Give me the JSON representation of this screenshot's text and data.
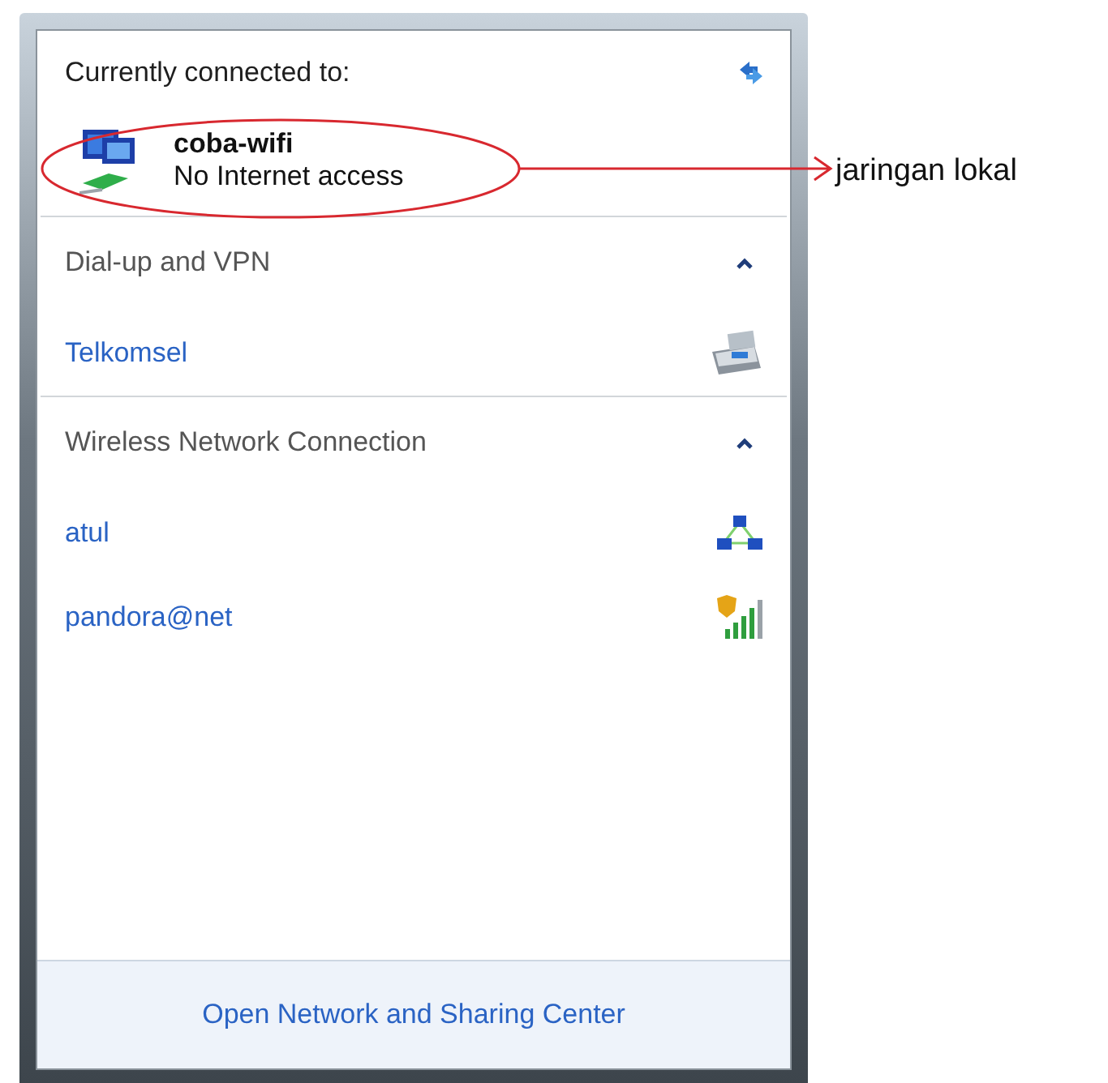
{
  "header": {
    "title": "Currently connected to:"
  },
  "connected": {
    "name": "coba-wifi",
    "status": "No Internet access"
  },
  "sections": [
    {
      "title": "Dial-up and VPN",
      "expanded": true,
      "items": [
        {
          "name": "Telkomsel",
          "kind": "dialup"
        }
      ]
    },
    {
      "title": "Wireless Network Connection",
      "expanded": true,
      "items": [
        {
          "name": "atul",
          "kind": "adhoc"
        },
        {
          "name": "pandora@net",
          "kind": "secured_wifi"
        }
      ]
    }
  ],
  "footer": {
    "link": "Open Network and Sharing Center"
  },
  "annotation": {
    "label": "jaringan lokal"
  }
}
